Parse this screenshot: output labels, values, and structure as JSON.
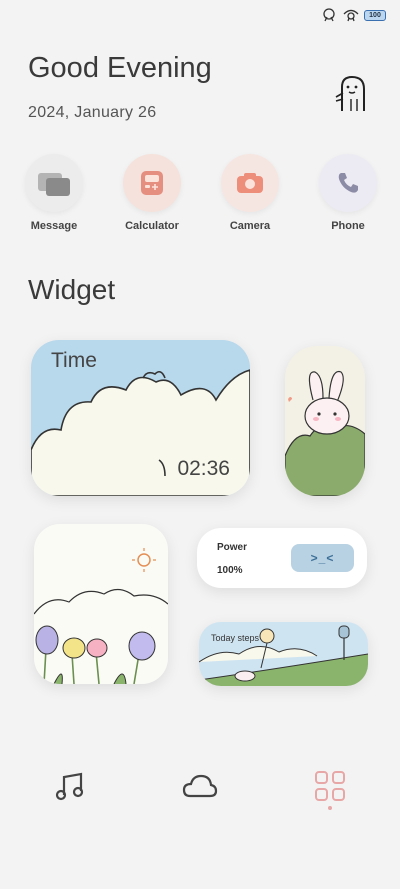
{
  "status": {
    "battery": "100"
  },
  "header": {
    "greeting": "Good Evening",
    "date": "2024, January 26"
  },
  "apps": [
    {
      "label": "Message",
      "icon": "message-icon",
      "color": "#9a9a9a"
    },
    {
      "label": "Calculator",
      "icon": "calculator-icon",
      "color": "#e9988a"
    },
    {
      "label": "Camera",
      "icon": "camera-icon",
      "color": "#ef9a88"
    },
    {
      "label": "Phone",
      "icon": "phone-icon",
      "color": "#8f8fa8"
    }
  ],
  "section": {
    "title": "Widget"
  },
  "widgets": {
    "time": {
      "title": "Time",
      "clock": "02:36"
    },
    "power": {
      "label": "Power",
      "value": "100%",
      "face": ">_<"
    },
    "steps": {
      "label": "Today steps"
    }
  },
  "dock": {
    "icons": [
      "music-icon",
      "cloud-icon",
      "apps-grid-icon"
    ],
    "active_color": "#e8a7a7"
  }
}
